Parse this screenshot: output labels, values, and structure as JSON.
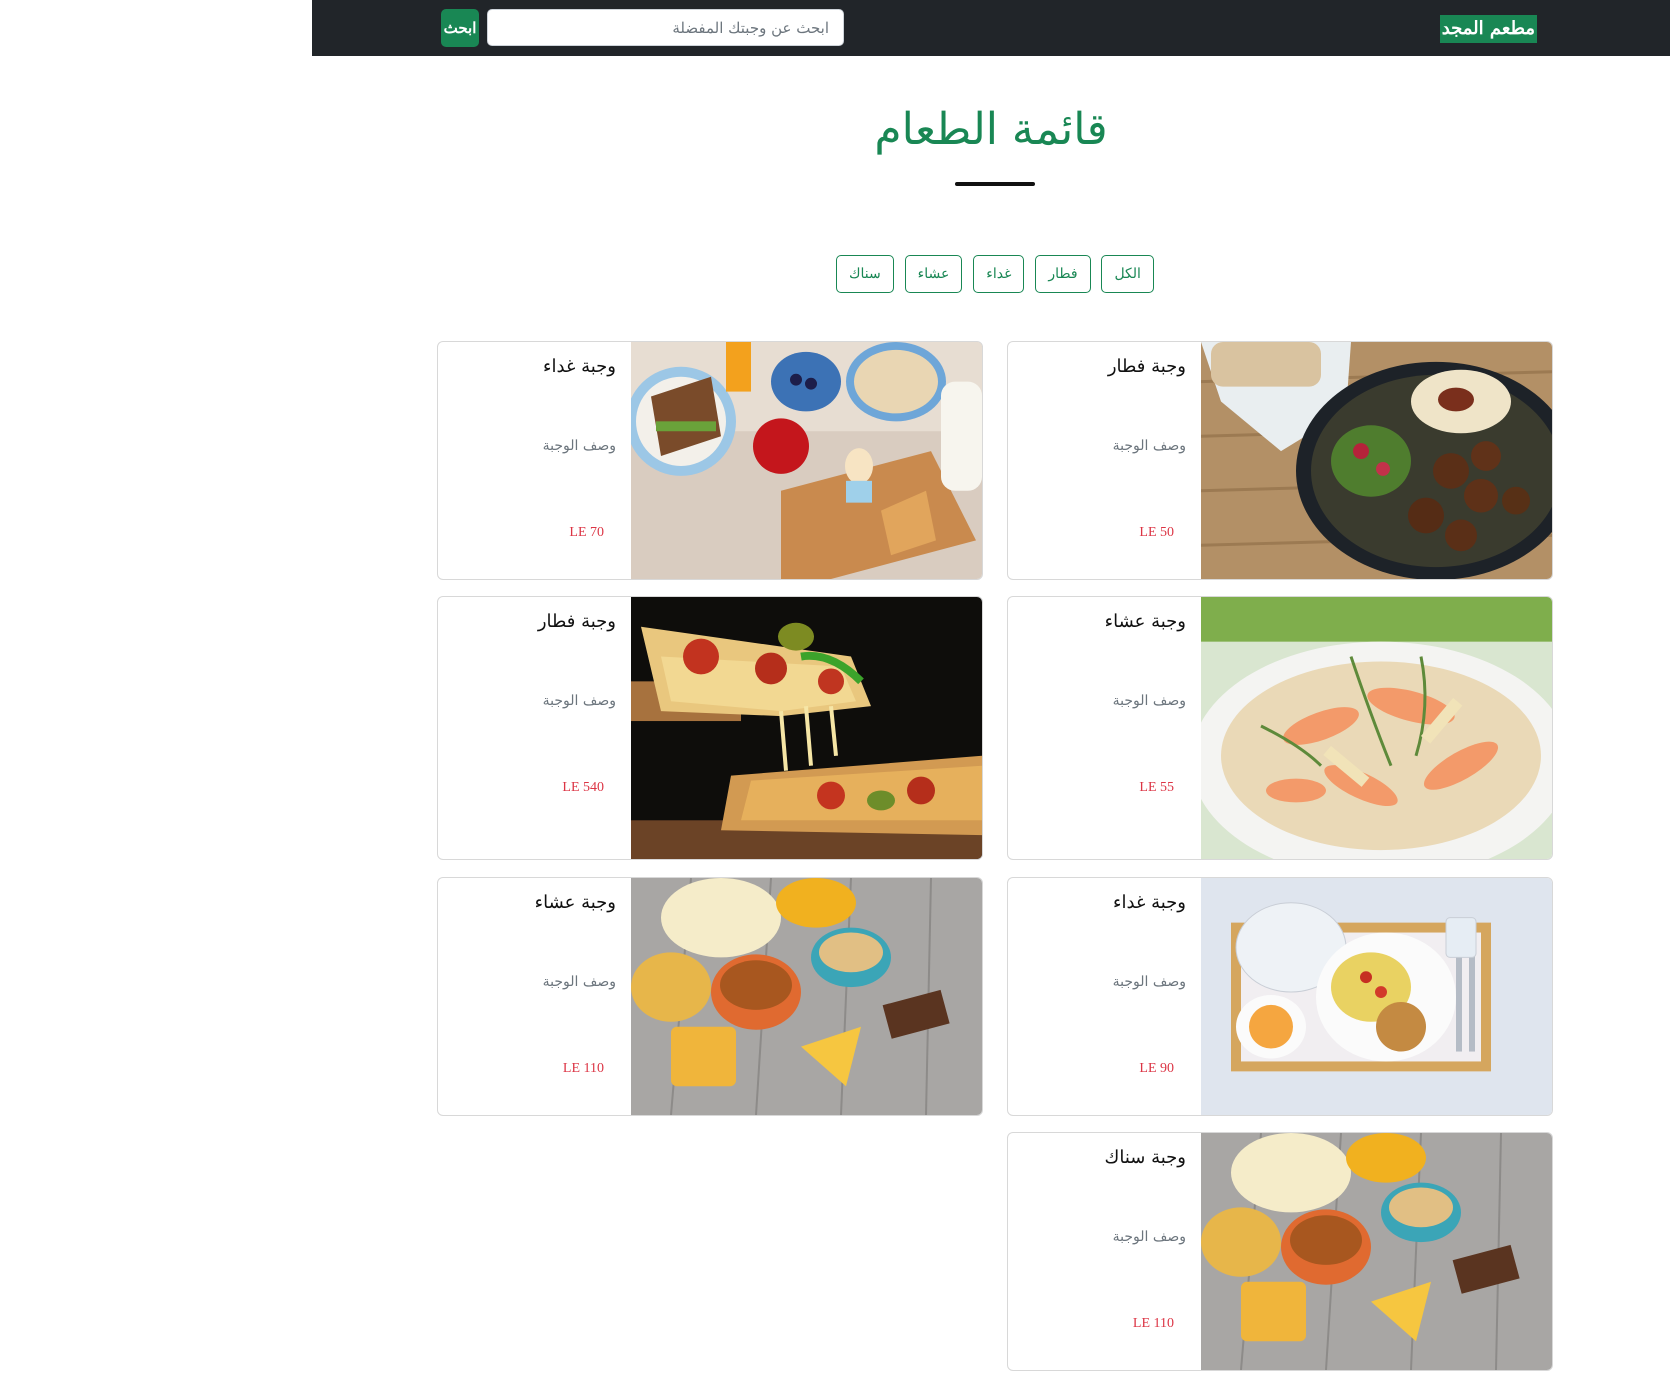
{
  "navbar": {
    "brand": "مطعم المجد",
    "search_placeholder": "ابحث عن وجبتك المفضلة",
    "search_button": "ابحث"
  },
  "page": {
    "title": "قائمة الطعام"
  },
  "filters": [
    "الكل",
    "فطار",
    "غداء",
    "عشاء",
    "سناك"
  ],
  "cards": [
    {
      "name": "وجبة فطار",
      "description": "وصف الوجبة",
      "price": "LE 50",
      "image": "falafel-plate"
    },
    {
      "name": "وجبة غداء",
      "description": "وصف الوجبة",
      "price": "LE 70",
      "image": "breakfast-spread"
    },
    {
      "name": "وجبة عشاء",
      "description": "وصف الوجبة",
      "price": "LE 55",
      "image": "salmon-pasta"
    },
    {
      "name": "وجبة فطار",
      "description": "وصف الوجبة",
      "price": "LE 540",
      "image": "pizza-slice"
    },
    {
      "name": "وجبة غداء",
      "description": "وصف الوجبة",
      "price": "LE 90",
      "image": "meal-tray"
    },
    {
      "name": "وجبة عشاء",
      "description": "وصف الوجبة",
      "price": "LE 110",
      "image": "snacks-table"
    },
    {
      "name": "وجبة سناك",
      "description": "وصف الوجبة",
      "price": "LE 110",
      "image": "snacks-table"
    }
  ]
}
